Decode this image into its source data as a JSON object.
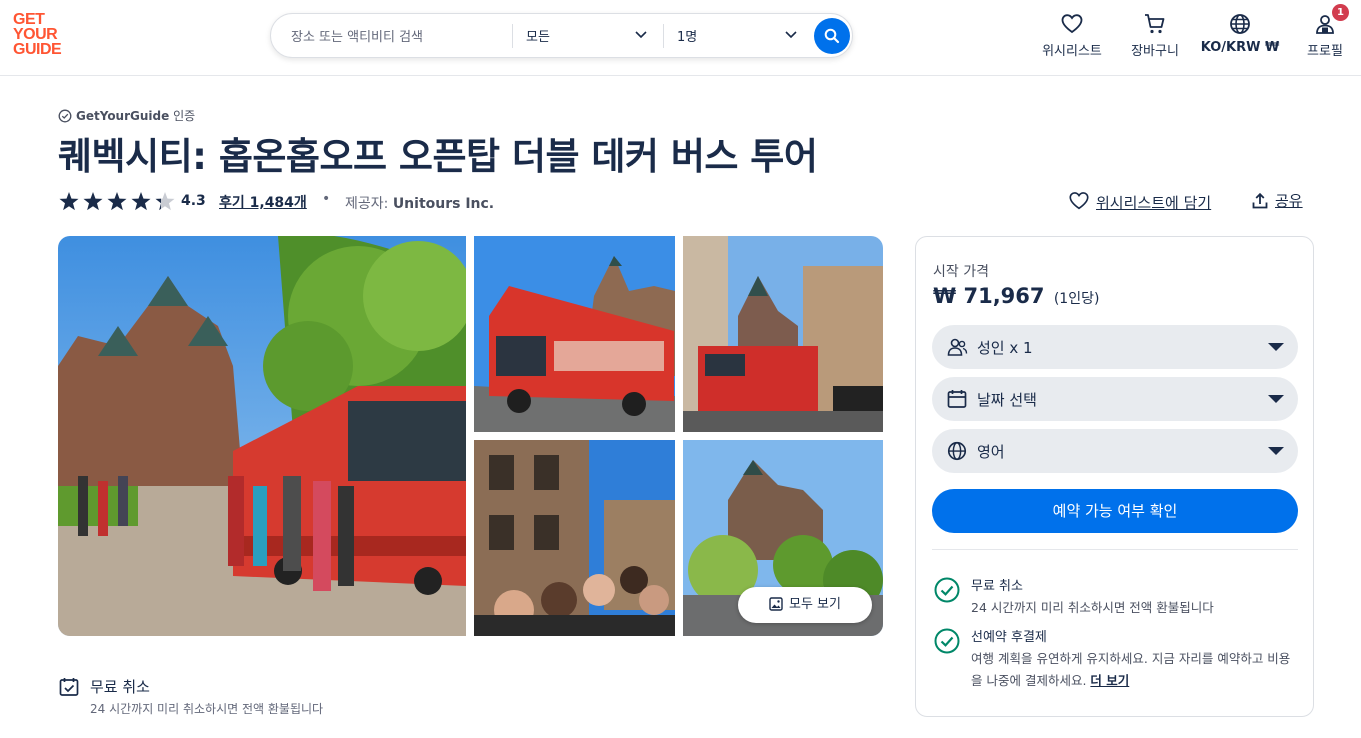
{
  "logo": {
    "line1": "GET",
    "line2": "YOUR",
    "line3": "GUIDE"
  },
  "search": {
    "placeholder": "장소 또는 액티비티 검색",
    "category_value": "모든",
    "guests_value": "1명"
  },
  "nav": {
    "wishlist": "위시리스트",
    "cart": "장바구니",
    "currency": "KO/KRW ₩",
    "profile": "프로필",
    "profile_badge": "1"
  },
  "product": {
    "certified_brand": "GetYourGuide",
    "certified_suffix": "인증",
    "title": "퀘벡시티: 홉온홉오프 오픈탑 더블 데커 버스 투어",
    "rating_value": 4.3,
    "rating_text": "4.3",
    "reviews_text": "후기 1,484개",
    "separator": "•",
    "provider_label": "제공자:",
    "provider_name": "Unitours Inc.",
    "wishlist_action": "위시리스트에 담기",
    "share_action": "공유"
  },
  "gallery": {
    "see_all": "모두 보기"
  },
  "free_cancel_under": {
    "title": "무료 취소",
    "subtitle": "24 시간까지 미리 취소하시면 전액 환불됩니다"
  },
  "booking": {
    "from_label": "시작 가격",
    "price": "₩ 71,967",
    "per_person": "(1인당)",
    "participants": "성인 x 1",
    "date": "날짜 선택",
    "language": "영어",
    "cta": "예약 가능 여부 확인",
    "features": [
      {
        "title": "무료 취소",
        "desc": "24 시간까지 미리 취소하시면 전액 환불됩니다"
      },
      {
        "title": "선예약 후결제",
        "desc": "여행 계획을 유연하게 유지하세요. 지금 자리를 예약하고 비용을 나중에 결제하세요.",
        "more": "더 보기"
      }
    ]
  },
  "colors": {
    "brand": "#ff5533",
    "primary": "#0071eb",
    "text": "#1a2b49",
    "success": "#008768",
    "badge": "#d23c4e"
  }
}
